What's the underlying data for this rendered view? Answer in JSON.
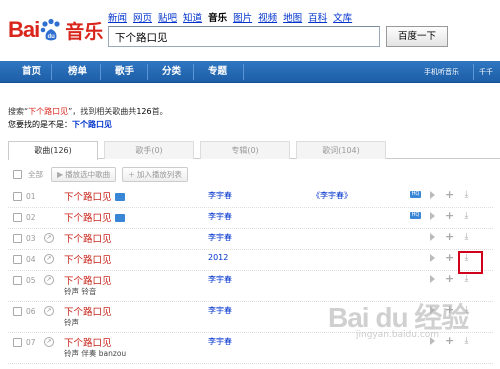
{
  "logo": {
    "text_bai": "Bai",
    "text_du": "du",
    "yinyue": "音乐"
  },
  "topnav": [
    {
      "label": "新闻",
      "current": false
    },
    {
      "label": "网页",
      "current": false
    },
    {
      "label": "贴吧",
      "current": false
    },
    {
      "label": "知道",
      "current": false
    },
    {
      "label": "音乐",
      "current": true
    },
    {
      "label": "图片",
      "current": false
    },
    {
      "label": "视频",
      "current": false
    },
    {
      "label": "地图",
      "current": false
    },
    {
      "label": "百科",
      "current": false
    },
    {
      "label": "文库",
      "current": false
    }
  ],
  "search": {
    "value": "下个路口见",
    "button": "百度一下"
  },
  "menu": {
    "items": [
      "首页",
      "榜单",
      "歌手",
      "分类",
      "专题"
    ],
    "right": [
      "手机听音乐",
      "千千"
    ]
  },
  "results": {
    "line1_pre": "搜索“",
    "keyword": "下个路口见",
    "line1_mid": "”，找到相关歌曲共",
    "count": "126",
    "line1_post": "首。",
    "line2_pre": "您要找的是不是：",
    "suggestion": "下个路口见"
  },
  "tabs": [
    {
      "label": "歌曲(126)",
      "active": true
    },
    {
      "label": "歌手(0)",
      "active": false
    },
    {
      "label": "专辑(0)",
      "active": false
    },
    {
      "label": "歌词(104)",
      "active": false
    }
  ],
  "toolbar": {
    "select_all": "全部",
    "play_selected": "播放选中歌曲",
    "add_to_list": "加入播放列表"
  },
  "rows": [
    {
      "num": "01",
      "title": "下个路口见",
      "sub": "",
      "artist": "李宇春",
      "album": "《李宇春》",
      "mv": true,
      "hq": "HQ",
      "dl_icon": false
    },
    {
      "num": "02",
      "title": "下个路口见",
      "sub": "",
      "artist": "李宇春",
      "album": "",
      "mv": true,
      "hq": "HQ",
      "dl_icon": false
    },
    {
      "num": "03",
      "title": "下个路口见",
      "sub": "",
      "artist": "李宇春",
      "album": "",
      "mv": false,
      "hq": "",
      "dl_icon": true
    },
    {
      "num": "04",
      "title": "下个路口见",
      "sub": "",
      "artist": "2012",
      "album": "",
      "mv": false,
      "hq": "",
      "dl_icon": true
    },
    {
      "num": "05",
      "title": "下个路口见",
      "sub": "铃声 铃音",
      "artist": "李宇春",
      "album": "",
      "mv": false,
      "hq": "",
      "dl_icon": true
    },
    {
      "num": "06",
      "title": "下个路口见",
      "sub": "铃声",
      "artist": "李宇春",
      "album": "",
      "mv": false,
      "hq": "",
      "dl_icon": true
    },
    {
      "num": "07",
      "title": "下个路口见",
      "sub": "铃声 伴奏 banzou",
      "artist": "李宇春",
      "album": "",
      "mv": false,
      "hq": "",
      "dl_icon": true
    }
  ],
  "watermark": {
    "main": "Bai du 经验",
    "sub": "jingyan.baidu.com"
  },
  "colors": {
    "brand_red": "#d9261c",
    "menu_blue": "#2a6cb6",
    "link_blue": "#0033cc",
    "highlight_box": "#d0021b"
  }
}
